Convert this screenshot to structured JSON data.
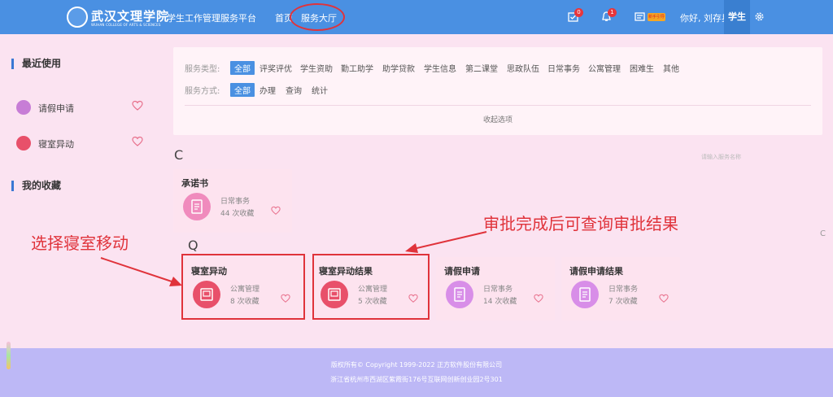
{
  "header": {
    "school_name_cn": "武汉文理学院",
    "school_name_en": "WUHAN COLLEGE OF ARTS & SCIENCES",
    "platform_title": "学生工作管理服务平台",
    "nav": [
      {
        "label": "首页"
      },
      {
        "label": "服务大厅"
      }
    ],
    "todo_badge": "0",
    "notice_badge": "1",
    "vip_label": "新手引导",
    "greeting": "你好, 刘存星",
    "role": "学生"
  },
  "sidebar": {
    "recent_title": "最近使用",
    "recent_items": [
      {
        "label": "请假申请",
        "color": "#c77dd6"
      },
      {
        "label": "寝室异动",
        "color": "#e8506a"
      }
    ],
    "favorites_title": "我的收藏"
  },
  "filter": {
    "type_label": "服务类型:",
    "types": [
      "全部",
      "评奖评优",
      "学生资助",
      "勤工助学",
      "助学贷款",
      "学生信息",
      "第二课堂",
      "思政队伍",
      "日常事务",
      "公寓管理",
      "困难生",
      "其他"
    ],
    "mode_label": "服务方式:",
    "modes": [
      "全部",
      "办理",
      "查询",
      "统计"
    ],
    "collapse_label": "收起选项"
  },
  "sort_letter": "C",
  "sort_hint": "请输入服务名称",
  "q_letter": "Q",
  "cards": [
    {
      "title": "承诺书",
      "category": "日常事务",
      "favorites": "44 次收藏",
      "color": "#f08bbd"
    },
    {
      "title": "寝室异动",
      "category": "公寓管理",
      "favorites": "8 次收藏",
      "color": "#e8506a"
    },
    {
      "title": "寝室异动结果",
      "category": "公寓管理",
      "favorites": "5 次收藏",
      "color": "#e8506a"
    },
    {
      "title": "请假申请",
      "category": "日常事务",
      "favorites": "14 次收藏",
      "color": "#d88ee8"
    },
    {
      "title": "请假申请结果",
      "category": "日常事务",
      "favorites": "7 次收藏",
      "color": "#d88ee8"
    }
  ],
  "annotations": {
    "left": "选择寝室移动",
    "right": "审批完成后可查询审批结果"
  },
  "footer": {
    "line1": "版权所有© Copyright 1999-2022 正方软件股份有限公司",
    "line2": "浙江省杭州市西湖区紫霞街176号互联网创新创业园2号301"
  },
  "side_letter": "C",
  "accent_color": "#4a90e2",
  "annotation_color": "#e0333b"
}
